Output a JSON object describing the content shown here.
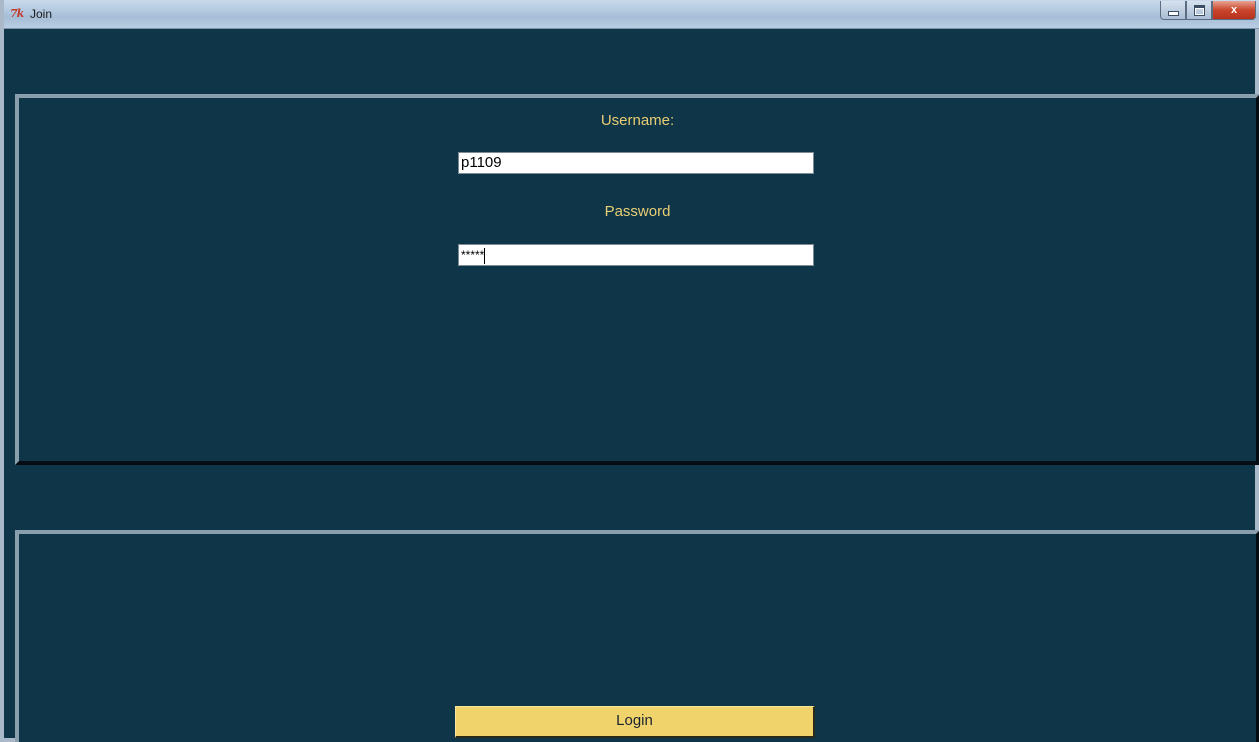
{
  "window": {
    "title": "Join",
    "icon": "tk-feather-icon",
    "controls": {
      "minimize_icon": "minimize-icon",
      "maximize_icon": "maximize-icon",
      "close_icon": "close-icon",
      "close_glyph": "x"
    }
  },
  "form": {
    "username_label": "Username:",
    "username_value": "p1109",
    "password_label": "Password",
    "password_value": "*****"
  },
  "actions": {
    "login_label": "Login"
  },
  "colors": {
    "background": "#0f3549",
    "label_text": "#e8ce73",
    "button_fill": "#f0d36b"
  }
}
